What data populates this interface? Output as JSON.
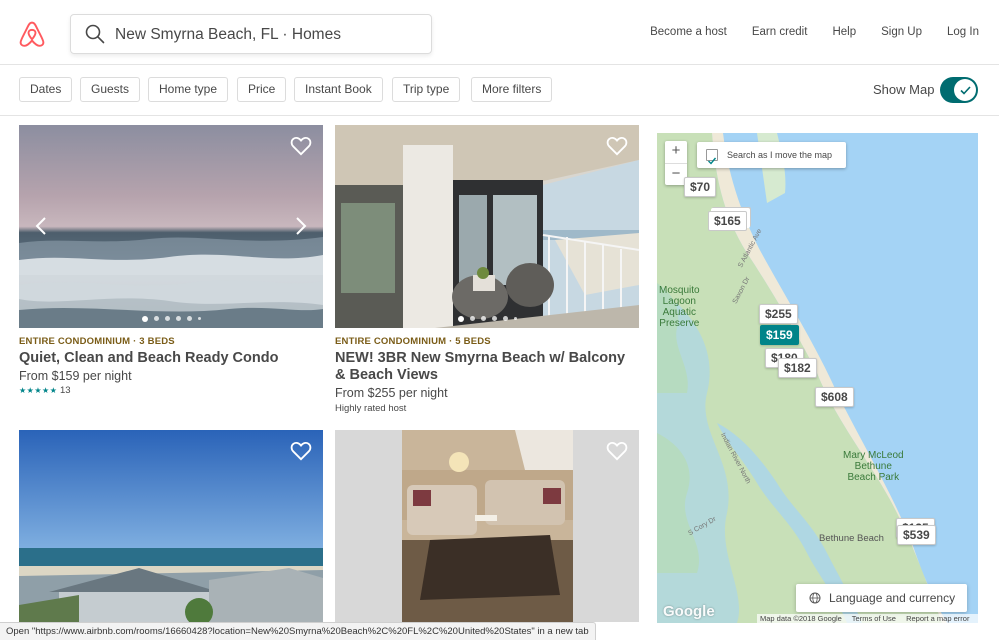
{
  "header": {
    "search_value": "New Smyrna Beach, FL · Homes",
    "nav": [
      "Become a host",
      "Earn credit",
      "Help",
      "Sign Up",
      "Log In"
    ]
  },
  "filters": {
    "chips": [
      "Dates",
      "Guests",
      "Home type",
      "Price",
      "Instant Book",
      "Trip type",
      "More filters"
    ],
    "show_map_label": "Show Map",
    "show_map_on": true
  },
  "listings": [
    {
      "kind": "ENTIRE CONDOMINIUM · 3 BEDS",
      "title": "Quiet, Clean and Beach Ready Condo",
      "price": "From $159  per night",
      "stars": "★★★★★",
      "review_count": "13"
    },
    {
      "kind": "ENTIRE CONDOMINIUM · 5 BEDS",
      "title": "NEW! 3BR New Smyrna Beach w/ Balcony & Beach Views",
      "price": "From $255  per night",
      "note": "Highly rated host"
    },
    {},
    {}
  ],
  "map": {
    "search_as_move": "Search as I move the map",
    "search_as_move_checked": true,
    "zoom_in": "+",
    "zoom_out": "−",
    "pins": [
      "$70",
      "$165",
      "$255",
      "$159",
      "$180",
      "$182",
      "$608",
      "$135",
      "$539"
    ],
    "labels": {
      "lagoon": "Mosquito\nLagoon\nAquatic\nPreserve",
      "park": "Mary McLeod\nBethune\nBeach Park",
      "bethune": "Bethune Beach",
      "atlantic": "S Atlantic Ave",
      "saxon": "Saxon Dr",
      "indian": "Indian River North",
      "cory": "S Cory Dr"
    },
    "language_button": "Language and currency",
    "google": "Google",
    "attribution": [
      "Map data ©2018 Google",
      "Terms of Use",
      "Report a map error"
    ]
  },
  "status_bar": "Open \"https://www.airbnb.com/rooms/16660428?location=New%20Smyrna%20Beach%2C%20FL%2C%20United%20States\" in a new tab",
  "colors": {
    "brand": "#FF5A5F",
    "teal": "#008489",
    "toggle": "#006c70"
  }
}
